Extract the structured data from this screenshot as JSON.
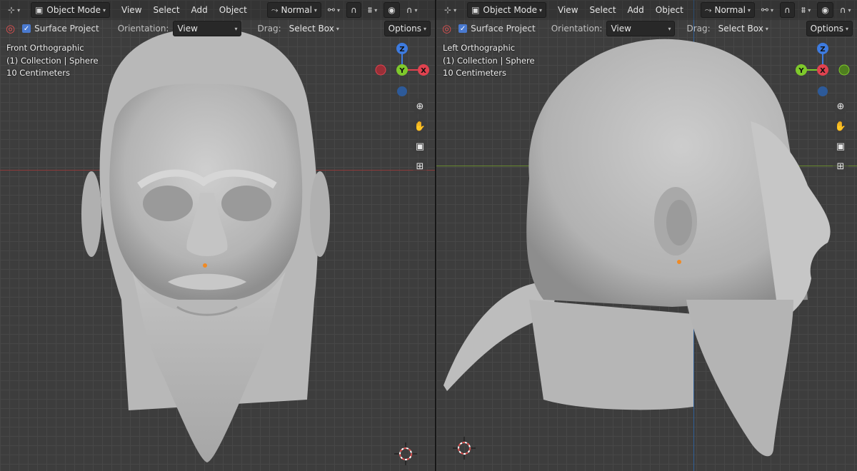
{
  "left_viewport": {
    "header": {
      "editor_type_icon": "editor-type-icon",
      "mode": "Object Mode",
      "menus": [
        "View",
        "Select",
        "Add",
        "Object"
      ],
      "orientation": "Normal"
    },
    "toolbar": {
      "surface_project_label": "Surface Project",
      "surface_project_checked": true,
      "orientation_label": "Orientation:",
      "orientation_value": "View",
      "drag_label": "Drag:",
      "drag_value": "Select Box",
      "options_label": "Options"
    },
    "info": {
      "view_name": "Front Orthographic",
      "collection": "(1) Collection | Sphere",
      "scale": "10 Centimeters"
    },
    "gizmo": {
      "z": "Z",
      "y": "Y",
      "x": "X"
    }
  },
  "right_viewport": {
    "header": {
      "editor_type_icon": "editor-type-icon",
      "mode": "Object Mode",
      "menus": [
        "View",
        "Select",
        "Add",
        "Object"
      ],
      "orientation": "Normal"
    },
    "toolbar": {
      "surface_project_label": "Surface Project",
      "surface_project_checked": true,
      "orientation_label": "Orientation:",
      "orientation_value": "View",
      "drag_label": "Drag:",
      "drag_value": "Select Box",
      "options_label": "Options"
    },
    "info": {
      "view_name": "Left Orthographic",
      "collection": "(1) Collection | Sphere",
      "scale": "10 Centimeters"
    },
    "gizmo": {
      "z": "Z",
      "y": "Y",
      "x": "X"
    }
  },
  "colors": {
    "axis_x": "#e0424f",
    "axis_y": "#7ec92b",
    "axis_z": "#3d7be0",
    "active_button": "#4772b3",
    "viewport_bg": "#3d3d3d"
  }
}
